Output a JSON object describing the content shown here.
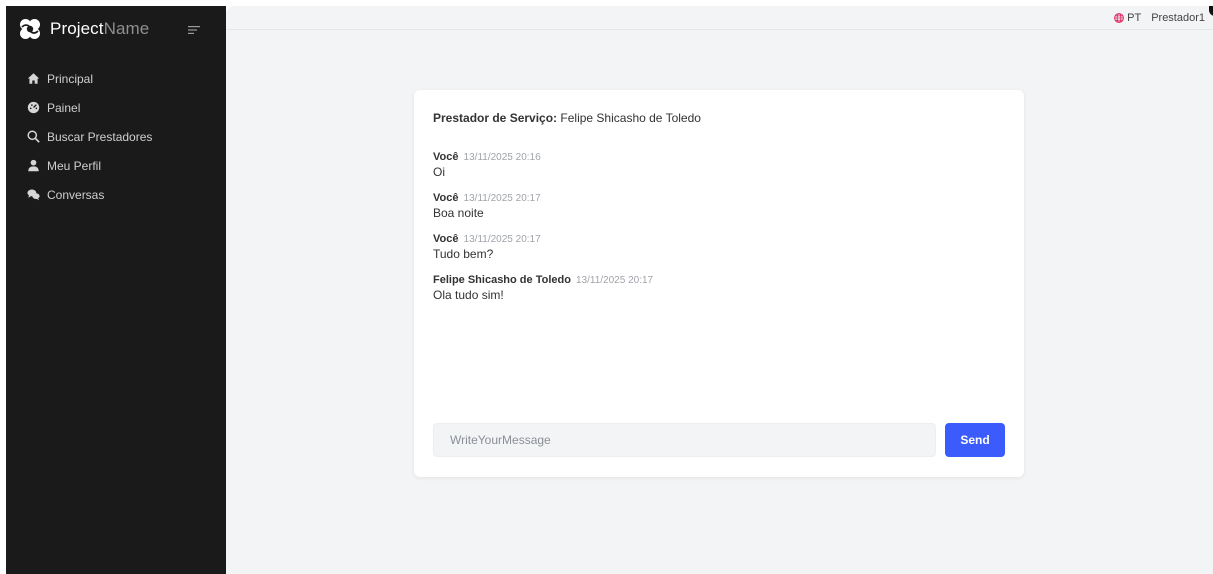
{
  "brand": {
    "name_bold": "Project",
    "name_light": "Name",
    "logo_icon": "project-logo-icon",
    "toggle_icon": "menu-toggle-icon"
  },
  "sidebar": {
    "items": [
      {
        "label": "Principal",
        "icon": "home-icon"
      },
      {
        "label": "Painel",
        "icon": "dashboard-icon"
      },
      {
        "label": "Buscar Prestadores",
        "icon": "search-icon"
      },
      {
        "label": "Meu Perfil",
        "icon": "user-icon"
      },
      {
        "label": "Conversas",
        "icon": "chat-icon"
      }
    ]
  },
  "topbar": {
    "language": "PT",
    "language_icon": "globe-icon",
    "user": "Prestador1"
  },
  "chat": {
    "header_label": "Prestador de Serviço:",
    "header_value": "Felipe Shicasho de Toledo",
    "messages": [
      {
        "author": "Você",
        "time": "13/11/2025 20:16",
        "text": "Oi"
      },
      {
        "author": "Você",
        "time": "13/11/2025 20:17",
        "text": "Boa noite"
      },
      {
        "author": "Você",
        "time": "13/11/2025 20:17",
        "text": "Tudo bem?"
      },
      {
        "author": "Felipe Shicasho de Toledo",
        "time": "13/11/2025 20:17",
        "text": "Ola tudo sim!"
      }
    ],
    "input_placeholder": "WriteYourMessage",
    "input_value": "",
    "send_label": "Send"
  },
  "colors": {
    "sidebar_bg": "#1a1a1a",
    "main_bg": "#f3f4f6",
    "accent": "#3b5bfd",
    "globe": "#e0245e"
  }
}
